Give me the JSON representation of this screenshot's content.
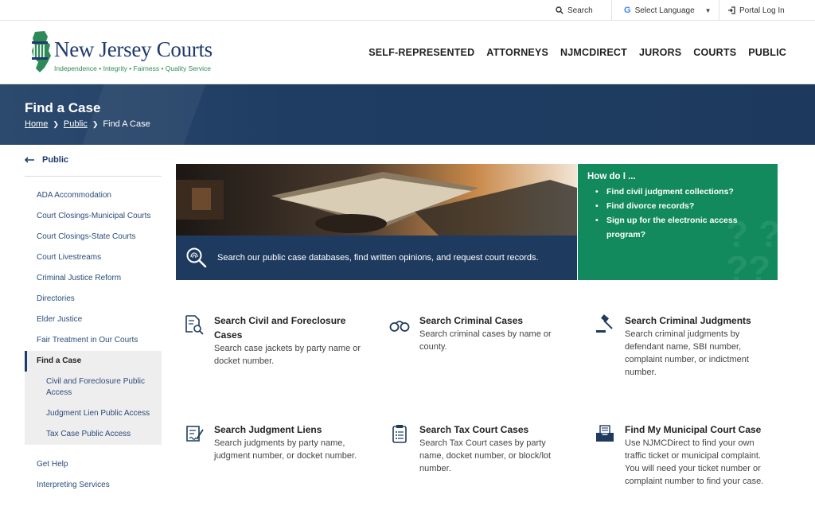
{
  "utility": {
    "search_label": "Search",
    "language_label": "Select Language",
    "portal_label": "Portal Log In"
  },
  "brand": {
    "title": "New Jersey Courts",
    "tagline": "Independence • Integrity • Fairness • Quality Service"
  },
  "nav": [
    {
      "label": "SELF-REPRESENTED"
    },
    {
      "label": "ATTORNEYS"
    },
    {
      "label": "NJMCDIRECT"
    },
    {
      "label": "JURORS"
    },
    {
      "label": "COURTS"
    },
    {
      "label": "PUBLIC"
    }
  ],
  "banner": {
    "title": "Find a Case",
    "breadcrumb": [
      "Home",
      "Public",
      "Find A Case"
    ]
  },
  "sidebar": {
    "back_label": "Public",
    "items": [
      {
        "label": "ADA Accommodation",
        "state": "normal"
      },
      {
        "label": "Court Closings-Municipal Courts",
        "state": "normal"
      },
      {
        "label": "Court Closings-State Courts",
        "state": "normal"
      },
      {
        "label": "Court Livestreams",
        "state": "normal"
      },
      {
        "label": "Criminal Justice Reform",
        "state": "normal"
      },
      {
        "label": "Directories",
        "state": "normal"
      },
      {
        "label": "Elder Justice",
        "state": "normal"
      },
      {
        "label": "Fair Treatment in Our Courts",
        "state": "normal"
      },
      {
        "label": "Find a Case",
        "state": "active"
      },
      {
        "label": "Civil and Foreclosure Public Access",
        "state": "sub"
      },
      {
        "label": "Judgment Lien Public Access",
        "state": "sub"
      },
      {
        "label": "Tax Case Public Access",
        "state": "sub"
      },
      {
        "label": "Get Help",
        "state": "normal"
      },
      {
        "label": "Interpreting Services",
        "state": "normal"
      }
    ]
  },
  "hero": {
    "caption": "Search our public case databases, find written opinions, and request court records."
  },
  "howdo": {
    "title": "How do I ...",
    "items": [
      "Find civil judgment collections?",
      "Find divorce records?",
      "Sign up for the electronic access program?"
    ]
  },
  "cards": [
    {
      "title": "Search Civil and Foreclosure Cases",
      "desc": "Search case jackets by party name or docket number.",
      "icon": "document-search-icon"
    },
    {
      "title": "Search Criminal Cases",
      "desc": "Search criminal cases by name or county.",
      "icon": "handcuffs-icon"
    },
    {
      "title": "Search Criminal Judgments",
      "desc": "Search criminal judgments by defendant name, SBI number, complaint number, or indictment number.",
      "icon": "gavel-icon"
    },
    {
      "title": "Search Judgment Liens",
      "desc": "Search judgments by party name, judgment number, or docket number.",
      "icon": "signed-document-icon"
    },
    {
      "title": "Search Tax Court Cases",
      "desc": "Search Tax Court cases by party name, docket number, or block/lot number.",
      "icon": "clipboard-icon"
    },
    {
      "title": "Find My Municipal Court Case",
      "desc": "Use NJMCDirect to find your own traffic ticket or municipal complaint. You will need your ticket number or complaint number to find your case.",
      "icon": "mail-tray-icon"
    }
  ],
  "colors": {
    "navy": "#1e3a5e",
    "green": "#128a5e",
    "link": "#2a4d7a"
  }
}
